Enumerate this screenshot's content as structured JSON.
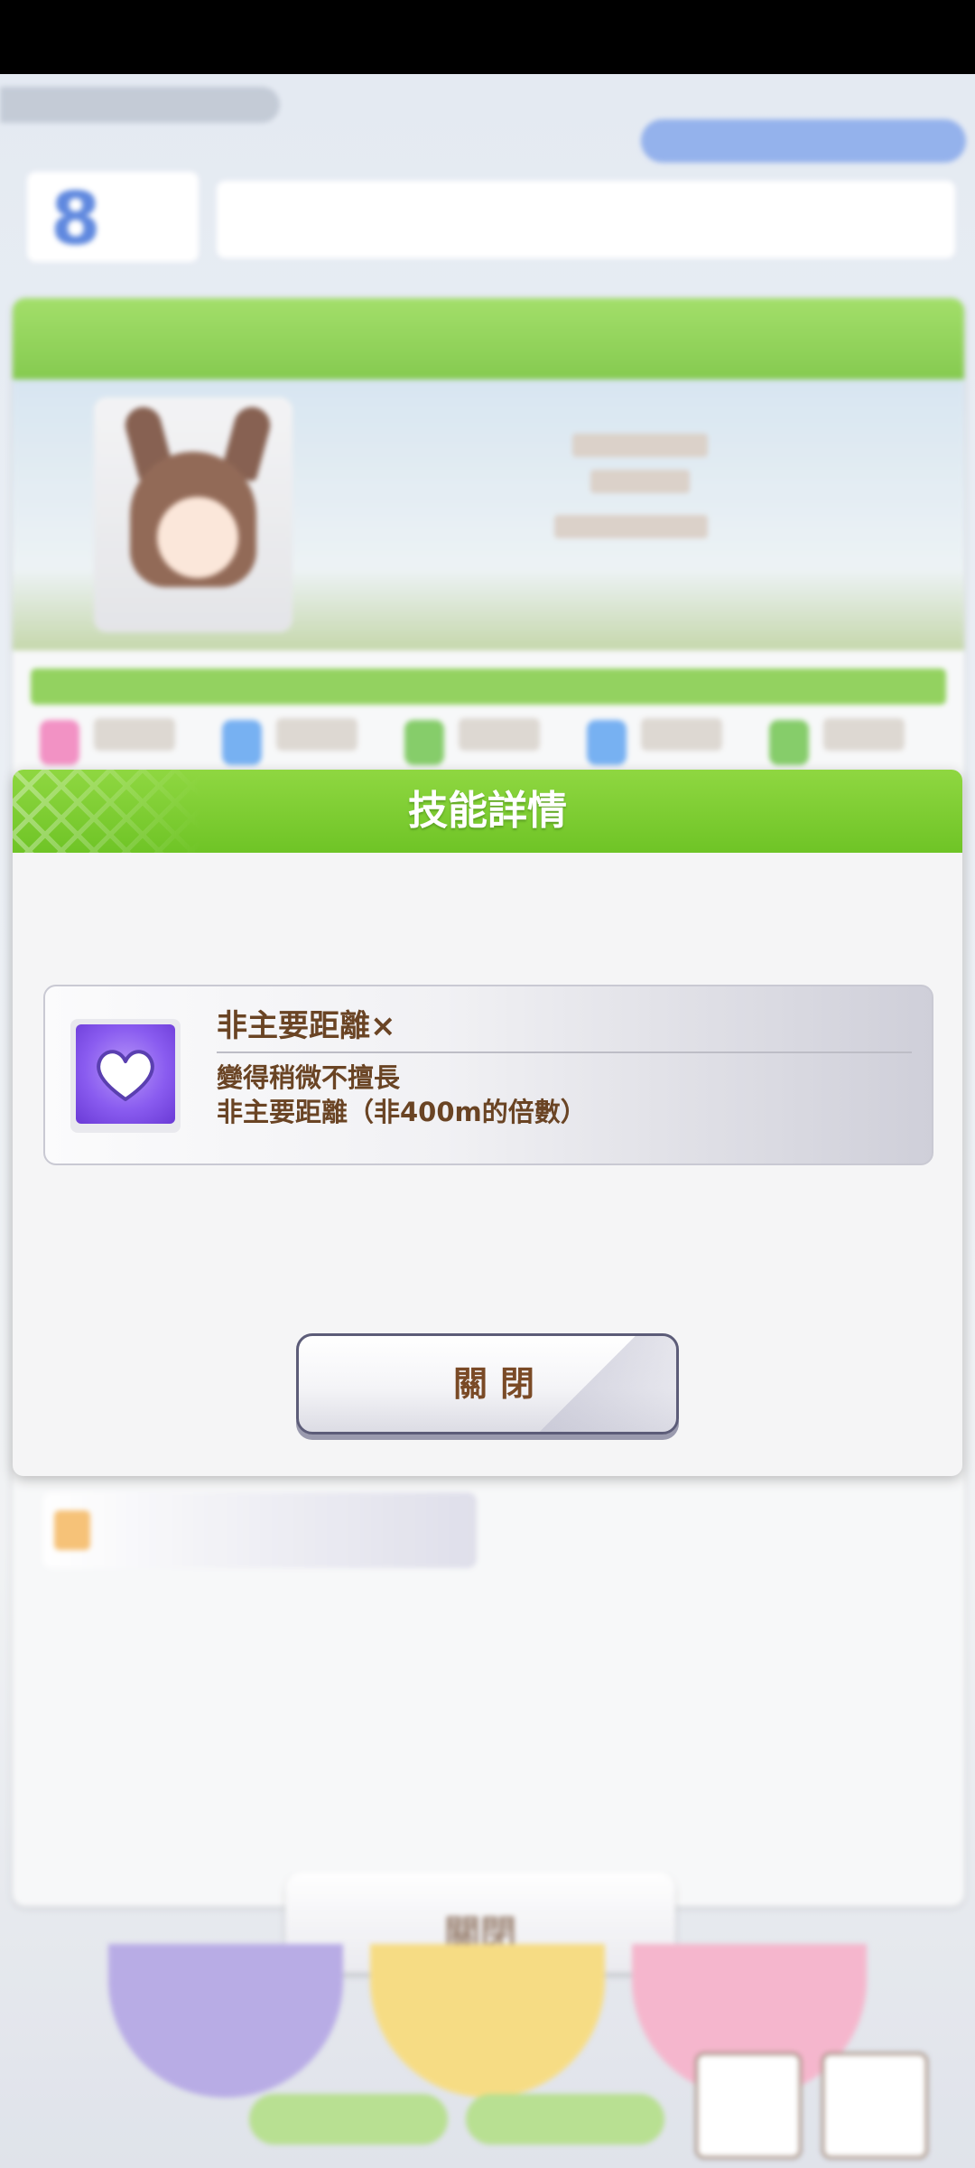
{
  "dialog": {
    "title": "技能詳情",
    "close_label": "關閉"
  },
  "skill": {
    "icon": "heart-icon",
    "name": "非主要距離×",
    "description_line1": "變得稍微不擅長",
    "description_line2": "非主要距離（非400m的倍數）",
    "icon_color": "#8a5cf0"
  },
  "colors": {
    "header_green": "#7ccc33",
    "text_brown": "#6a4424",
    "button_border": "#5c5c78"
  }
}
